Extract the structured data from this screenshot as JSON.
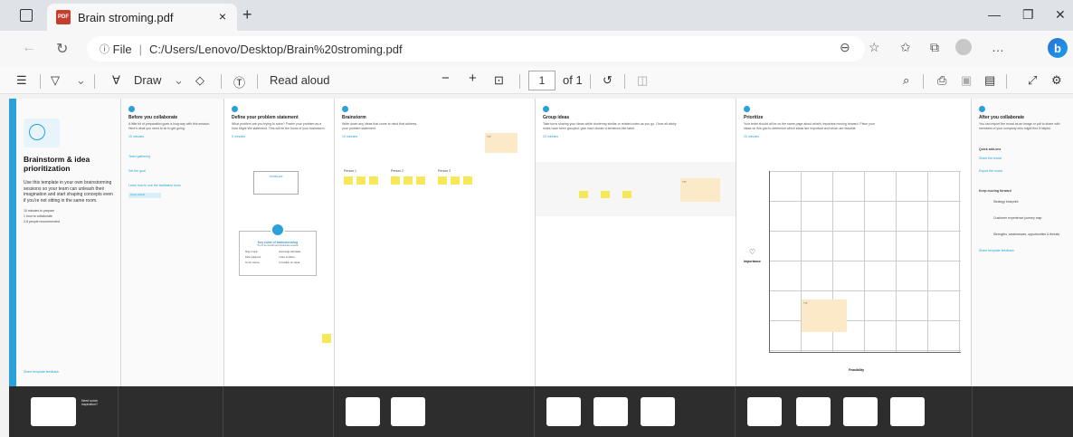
{
  "browser": {
    "tab_title": "Brain stroming.pdf",
    "pdf_badge": "PDF",
    "close_tab": "×",
    "new_tab": "+",
    "address_prefix": "File",
    "address_path": "C:/Users/Lenovo/Desktop/Brain%20stroming.pdf",
    "more": "…",
    "bing": "b"
  },
  "pdf_toolbar": {
    "draw_label": "Draw",
    "read_aloud_label": "Read aloud",
    "zoom_out": "−",
    "zoom_in": "+",
    "page_current": "1",
    "page_total": "of 1"
  },
  "panels": {
    "p1": {
      "title": "Brainstorm & idea prioritization",
      "desc": "Use this template in your own brainstorming sessions so your team can unleash their imagination and start shaping concepts even if you're not sitting in the same room.",
      "meta": [
        "10 minutes to prepare",
        "1 hour to collaborate",
        "2-8 people recommended"
      ],
      "footer_link": "Share template feedback"
    },
    "p2": {
      "title": "Before you collaborate",
      "text": "A little bit of preparation goes a long way with this session. Here's what you need to do to get going.",
      "tip": "10 minutes",
      "items": [
        "Team gathering",
        "Set the goal",
        "Learn how to use the facilitation tools"
      ],
      "button": "Open article"
    },
    "p3": {
      "title": "Define your problem statement",
      "text": "What problem are you trying to solve? Frame your problem as a How Might We statement. This will be the focus of your brainstorm.",
      "tip": "5 minutes",
      "box_title": "PROBLEM",
      "rules_title": "Key rules of brainstorming",
      "rules_sub": "To run an smooth and productive session",
      "rules": [
        "Stay in topic.",
        "Encourage wild ideas.",
        "Defer judgment.",
        "Listen to others.",
        "Go for volume.",
        "If possible, be visual."
      ]
    },
    "p4": {
      "title": "Brainstorm",
      "text": "Write down any ideas that come to mind that address your problem statement.",
      "tip": "10 minutes",
      "people": [
        "Person 1",
        "Person 2",
        "Person 3"
      ],
      "note_title": "TIP"
    },
    "p5": {
      "title": "Group ideas",
      "text": "Take turns sharing your ideas while clustering similar or related notes as you go. Once all sticky notes have been grouped, give each cluster a sentence-like label.",
      "tip": "20 minutes",
      "note_title": "TIP"
    },
    "p6": {
      "title": "Prioritize",
      "text": "Your team should all be on the same page about what's important moving forward. Place your ideas on this grid to determine which ideas are important and which are feasible.",
      "tip": "20 minutes",
      "y_axis": "Importance",
      "x_axis": "Feasibility",
      "note_title": "TIP"
    },
    "p7": {
      "title": "After you collaborate",
      "text": "You can export the mural as an image or pdf to share with members of your company who might find it helpful.",
      "quick_add": "Quick add-ons",
      "qa": [
        "Share the mural",
        "Export the mural"
      ],
      "keep_moving": "Keep moving forward",
      "km": [
        "Strategy blueprint",
        "Customer experience journey map",
        "Strengths, weaknesses, opportunities & threats"
      ],
      "footer_link": "Share template feedback"
    }
  },
  "thumbnails": {
    "t1": "Need some inspiration?"
  }
}
